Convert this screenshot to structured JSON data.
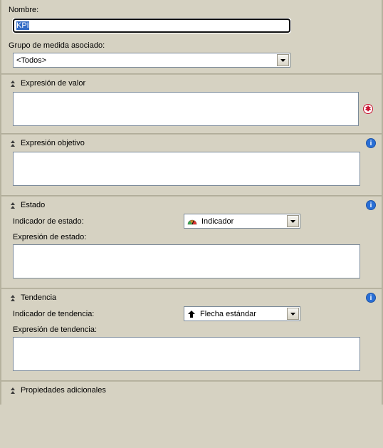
{
  "top": {
    "name_label": "Nombre:",
    "name_value": "KPI",
    "group_label": "Grupo de medida asociado:",
    "group_value": "<Todos>"
  },
  "sections": {
    "value": {
      "title": "Expresión de valor",
      "text": ""
    },
    "goal": {
      "title": "Expresión objetivo",
      "text": ""
    },
    "status": {
      "title": "Estado",
      "indicator_label": "Indicador de estado:",
      "indicator_value": "Indicador",
      "expr_label": "Expresión de estado:",
      "expr_text": ""
    },
    "trend": {
      "title": "Tendencia",
      "indicator_label": "Indicador de tendencia:",
      "indicator_value": "Flecha estándar",
      "expr_label": "Expresión de tendencia:",
      "expr_text": ""
    },
    "additional": {
      "title": "Propiedades adicionales"
    }
  }
}
